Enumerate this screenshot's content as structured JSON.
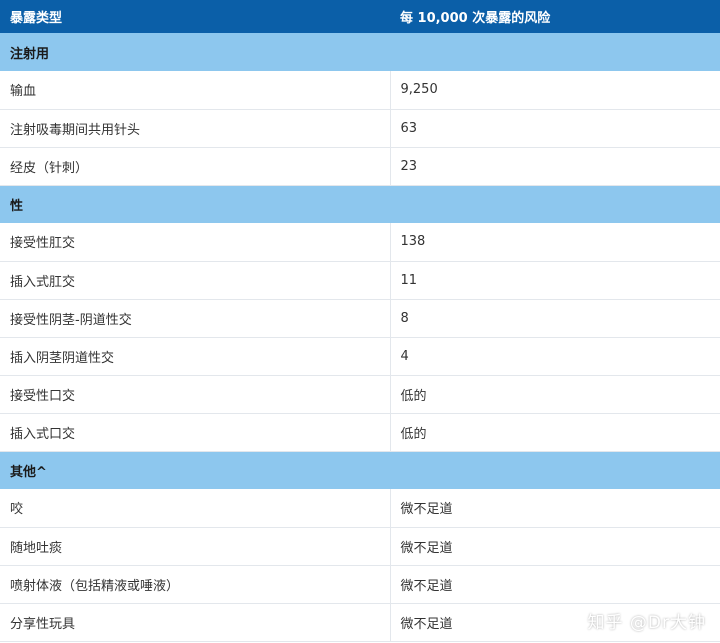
{
  "header": {
    "col1": "暴露类型",
    "col2": "每 10,000 次暴露的风险"
  },
  "sections": [
    {
      "title": "注射用",
      "rows": [
        {
          "label": "输血",
          "value": "9,250"
        },
        {
          "label": "注射吸毒期间共用针头",
          "value": "63"
        },
        {
          "label": "经皮（针刺）",
          "value": "23"
        }
      ]
    },
    {
      "title": "性",
      "rows": [
        {
          "label": "接受性肛交",
          "value": "138"
        },
        {
          "label": "插入式肛交",
          "value": "11"
        },
        {
          "label": "接受性阴茎-阴道性交",
          "value": "8"
        },
        {
          "label": "插入阴茎阴道性交",
          "value": "4"
        },
        {
          "label": "接受性口交",
          "value": "低的"
        },
        {
          "label": "插入式口交",
          "value": "低的"
        }
      ]
    },
    {
      "title": "其他^",
      "rows": [
        {
          "label": "咬",
          "value": "微不足道"
        },
        {
          "label": "随地吐痰",
          "value": "微不足道"
        },
        {
          "label": "喷射体液（包括精液或唾液）",
          "value": "微不足道"
        },
        {
          "label": "分享性玩具",
          "value": "微不足道"
        }
      ]
    }
  ],
  "watermark": "知乎 @Dr大钟",
  "colors": {
    "header_bg": "#0b5fa8",
    "section_bg": "#8dc7ee"
  }
}
